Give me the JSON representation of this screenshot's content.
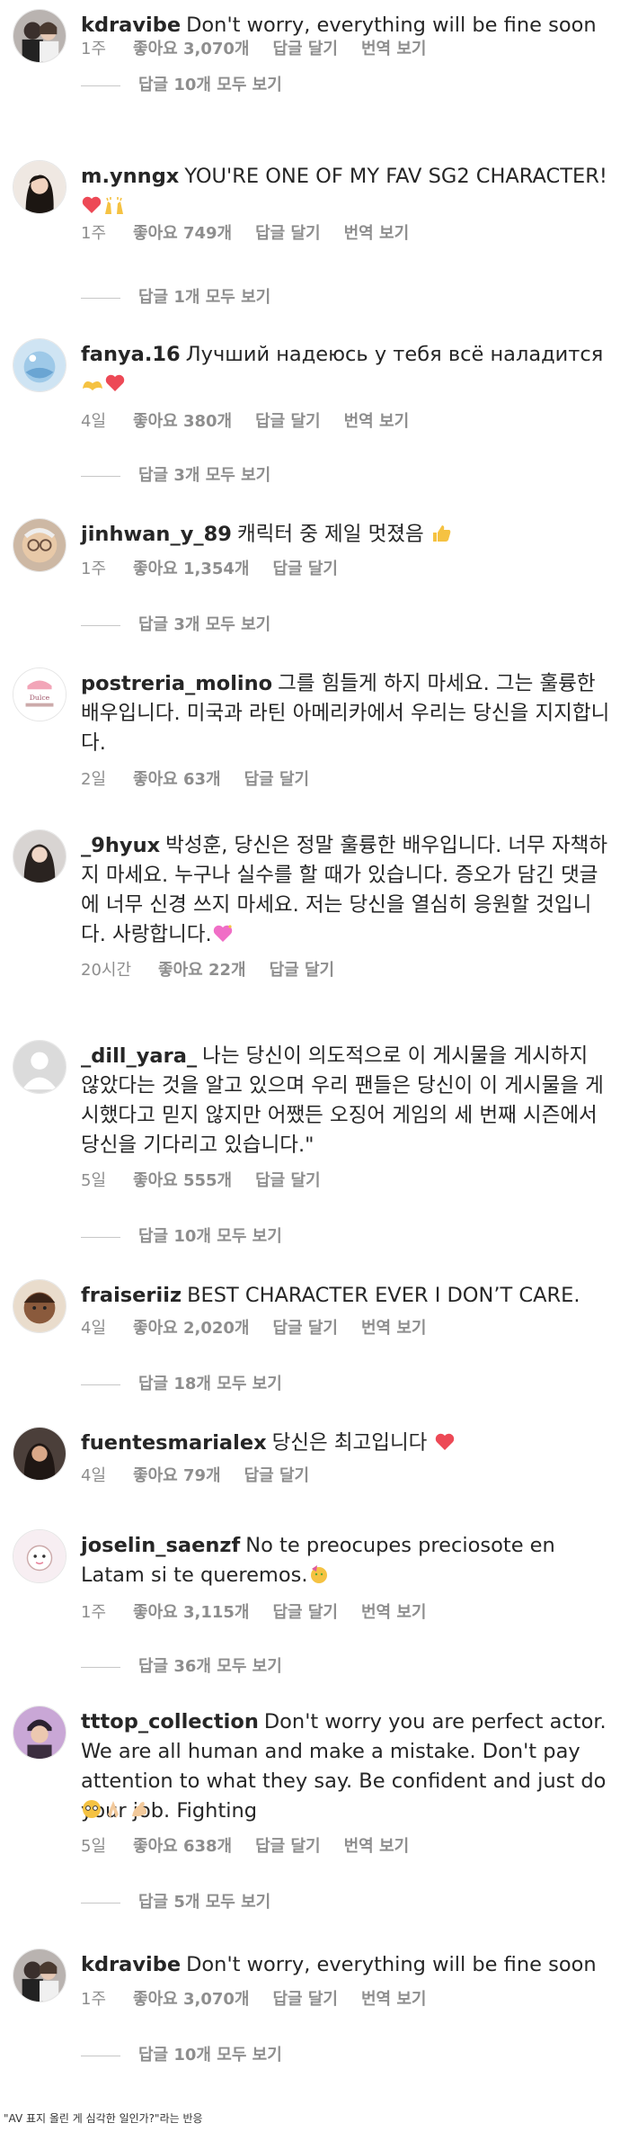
{
  "comments": [
    {
      "user": "kdravibe",
      "text": "Don't worry, everything will be fine soon",
      "time": "1주",
      "likes": "좋아요 3,070개",
      "reply": "답글 달기",
      "translate": "번역 보기",
      "view_replies": "답글 10개 모두 보기",
      "avatar": "couple-photo-avatar"
    },
    {
      "user": "m.ynngx",
      "text": "YOU'RE ONE OF MY FAV SG2 CHARACTER!",
      "time": "1주",
      "likes": "좋아요 749개",
      "reply": "답글 달기",
      "translate": "번역 보기",
      "view_replies": "답글 1개 모두 보기",
      "avatar": "woman-photo-avatar",
      "emojis": [
        "heart-emoji",
        "raised-hands-emoji"
      ]
    },
    {
      "user": "fanya.16",
      "text": "Лучший  надеюсь у тебя всё наладится",
      "time": "4일",
      "likes": "좋아요 380개",
      "reply": "답글 달기",
      "translate": "번역 보기",
      "view_replies": "답글 3개 모두 보기",
      "avatar": "planet-avatar",
      "emojis": [
        "heart-hands-emoji",
        "heart-emoji"
      ]
    },
    {
      "user": "jinhwan_y_89",
      "text": "캐릭터 중 제일 멋졌음",
      "time": "1주",
      "likes": "좋아요 1,354개",
      "reply": "답글 달기",
      "view_replies": "답글 3개 모두 보기",
      "avatar": "old-man-avatar",
      "emojis": [
        "thumbs-up-emoji"
      ]
    },
    {
      "user": "postreria_molino",
      "text": "그를 힘들게 하지 마세요. 그는 훌륭한 배우입니다. 미국과 라틴 아메리카에서 우리는 당신을 지지합니다.",
      "time": "2일",
      "likes": "좋아요 63개",
      "reply": "답글 달기",
      "avatar": "bakery-logo-avatar"
    },
    {
      "user": "_9hyux",
      "text": "박성훈, 당신은 정말 훌륭한 배우입니다. 너무 자책하지 마세요. 누구나 실수를 할 때가 있습니다. 증오가 담긴 댓글에 너무 신경 쓰지 마세요. 저는 당신을 열심히 응원할 것입니다. 사랑합니다.",
      "time": "20시간",
      "likes": "좋아요 22개",
      "reply": "답글 달기",
      "avatar": "girl-photo-avatar",
      "emojis": [
        "sparkling-heart-emoji"
      ]
    },
    {
      "user": "_dill_yara_",
      "text": "나는 당신이 의도적으로 이 게시물을 게시하지 않았다는 것을 알고 있으며 우리 팬들은 당신이 이 게시물을 게시했다고 믿지 않지만 어쨌든 오징어 게임의 세 번째 시즌에서 당신을 기다리고 있습니다.\"",
      "time": "5일",
      "likes": "좋아요 555개",
      "reply": "답글 달기",
      "view_replies": "답글 10개 모두 보기",
      "avatar": "default-user-avatar"
    },
    {
      "user": "fraiseriiz",
      "text": "BEST CHARACTER EVER I DON’T CARE.",
      "time": "4일",
      "likes": "좋아요 2,020개",
      "reply": "답글 달기",
      "translate": "번역 보기",
      "view_replies": "답글 18개 모두 보기",
      "avatar": "cartoon-avatar"
    },
    {
      "user": "fuentesmarialex",
      "text": "당신은 최고입니다",
      "time": "4일",
      "likes": "좋아요 79개",
      "reply": "답글 달기",
      "avatar": "woman-selfie-avatar",
      "emojis": [
        "heart-emoji"
      ]
    },
    {
      "user": "joselin_saenzf",
      "text": "No te preocupes preciosote en Latam si te queremos.",
      "time": "1주",
      "likes": "좋아요 3,115개",
      "reply": "답글 달기",
      "translate": "번역 보기",
      "view_replies": "답글 36개 모두 보기",
      "avatar": "cute-character-avatar",
      "emojis": [
        "partying-face-emoji"
      ]
    },
    {
      "user": "tttop_collection",
      "text": "Don't worry you are perfect actor. We are all human and make a mistake. Don't pay attention to what they say. Be confident and just do your job. Fighting",
      "time": "5일",
      "likes": "좋아요 638개",
      "reply": "답글 달기",
      "translate": "번역 보기",
      "view_replies": "답글 5개 모두 보기",
      "avatar": "man-photo-avatar",
      "emojis": [
        "pleading-face-emoji",
        "folded-hands-emoji",
        "flexed-biceps-emoji"
      ]
    },
    {
      "user": "kdravibe",
      "text": "Don't worry, everything will be fine soon",
      "time": "1주",
      "likes": "좋아요 3,070개",
      "reply": "답글 달기",
      "translate": "번역 보기",
      "view_replies": "답글 10개 모두 보기",
      "avatar": "couple-photo-avatar"
    }
  ],
  "caption": "\"AV 표지 올린 게 심각한 일인가?\"라는 반응",
  "colors": {
    "text": "#262626",
    "meta": "#8e8e8e",
    "heart": "#ed4956"
  }
}
